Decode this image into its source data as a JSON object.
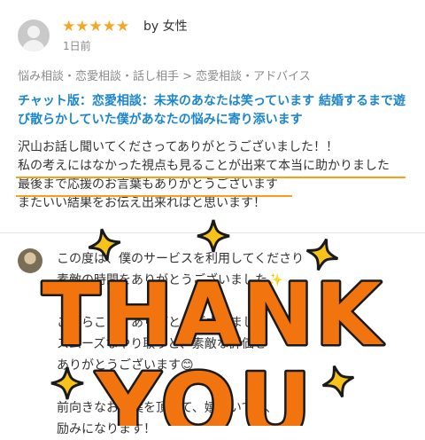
{
  "review": {
    "stars": "★★★★★",
    "rating": 5,
    "by": "by 女性",
    "date": "1日前",
    "category": "悩み相談・恋愛相談・話し相手 > 恋愛相談・アドバイス",
    "title": "チャット版：恋愛相談：未来のあなたは笑っています 結婚するまで遊び散らかしていた僕があなたの悩みに寄り添います",
    "body": [
      "沢山お話し聞いてくださってありがとうございました！！",
      "私の考えにはなかった視点も見ることが出来て本当に助かりました",
      "最後まで応援のお言葉もありがとうございます",
      "またいい結果をお伝え出来ればと思います！"
    ]
  },
  "reply": {
    "lines": [
      "この度は、僕のサービスを利用してくださり",
      "素敵の時間をありがとうございました✨",
      "",
      "こちらこそ、ありがとうございました",
      "スムーズなやり取りと、素敵な評価を",
      "ありがとうございます😊",
      "",
      "前向きなお言葉を頂いて、嬉しいです、",
      "励みになります！"
    ]
  },
  "sticker": {
    "line1": "THANK",
    "line2": "YOU",
    "fill": "#f2740f",
    "outline": "#1a1a1a",
    "star_color": "#f7c21a"
  },
  "colors": {
    "accent": "#1b86cf",
    "highlight": "#f7a11a",
    "star": "#f5a623"
  }
}
